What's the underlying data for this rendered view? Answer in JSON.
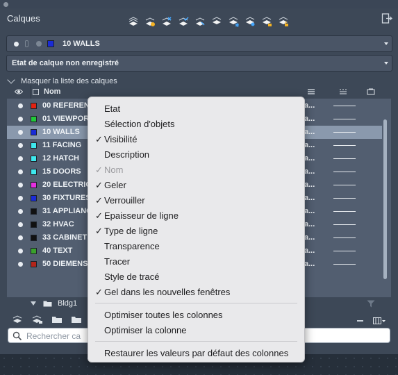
{
  "window": {
    "title": "Calques"
  },
  "toolbar": {
    "icons": [
      "new-layer-icon",
      "new-layer-vp-icon",
      "delete-layer-icon",
      "set-current-icon",
      "layer-states-icon",
      "layer-properties-icon",
      "isolate-icon",
      "freeze-icon",
      "lock-icon",
      "unlock-icon"
    ]
  },
  "current_layer": {
    "name": "10 WALLS",
    "color": "#1a2bd6"
  },
  "layer_state": {
    "label": "Etat de calque non enregistré"
  },
  "toggle": {
    "label": "Masquer la liste des calques"
  },
  "table": {
    "header_name": "Nom",
    "rows": [
      {
        "name": "00 REFEREN",
        "color": "#e32212",
        "last": "a...",
        "selected": false
      },
      {
        "name": "01 VIEWPOR",
        "color": "#22c93a",
        "last": "a...",
        "selected": false
      },
      {
        "name": "10 WALLS",
        "color": "#1a2bd6",
        "last": "a...",
        "selected": true
      },
      {
        "name": "11 FACING",
        "color": "#3ee8ee",
        "last": "a...",
        "selected": false
      },
      {
        "name": "12 HATCH",
        "color": "#3ee8ee",
        "last": "a...",
        "selected": false
      },
      {
        "name": "15 DOORS",
        "color": "#3ee8ee",
        "last": "a...",
        "selected": false
      },
      {
        "name": "20 ELECTRIC",
        "color": "#e52ee0",
        "last": "a...",
        "selected": false
      },
      {
        "name": "30 FIXTURES",
        "color": "#1a2bd6",
        "last": "a...",
        "selected": false
      },
      {
        "name": "31 APPLIANC",
        "color": "#111111",
        "last": "a...",
        "selected": false
      },
      {
        "name": "32 HVAC",
        "color": "#111111",
        "last": "a...",
        "selected": false
      },
      {
        "name": "33 CABINET",
        "color": "#111111",
        "last": "a...",
        "selected": false
      },
      {
        "name": "40 TEXT",
        "color": "#3aa12c",
        "last": "a...",
        "selected": false
      },
      {
        "name": "50 DIEMENS",
        "color": "#b3241a",
        "last": "a...",
        "selected": false
      }
    ]
  },
  "group": {
    "label": "Bldg1"
  },
  "search": {
    "placeholder": "Rechercher ca"
  },
  "context_menu": {
    "items": [
      {
        "label": "Etat",
        "checked": false,
        "disabled": false
      },
      {
        "label": "Sélection d'objets",
        "checked": false,
        "disabled": false
      },
      {
        "label": "Visibilité",
        "checked": true,
        "disabled": false
      },
      {
        "label": "Description",
        "checked": false,
        "disabled": false
      },
      {
        "label": "Nom",
        "checked": true,
        "disabled": true
      },
      {
        "label": "Geler",
        "checked": true,
        "disabled": false
      },
      {
        "label": "Verrouiller",
        "checked": true,
        "disabled": false
      },
      {
        "label": "Epaisseur de ligne",
        "checked": true,
        "disabled": false
      },
      {
        "label": "Type de ligne",
        "checked": true,
        "disabled": false
      },
      {
        "label": "Transparence",
        "checked": false,
        "disabled": false
      },
      {
        "label": "Tracer",
        "checked": false,
        "disabled": false
      },
      {
        "label": "Style de tracé",
        "checked": false,
        "disabled": false
      },
      {
        "label": "Gel dans les nouvelles fenêtres",
        "checked": true,
        "disabled": false
      }
    ],
    "column_actions": [
      {
        "label": "Optimiser toutes les colonnes"
      },
      {
        "label": "Optimiser la colonne"
      }
    ],
    "reset": {
      "label": "Restaurer les valeurs par défaut des colonnes"
    },
    "check_glyph": "✓"
  }
}
